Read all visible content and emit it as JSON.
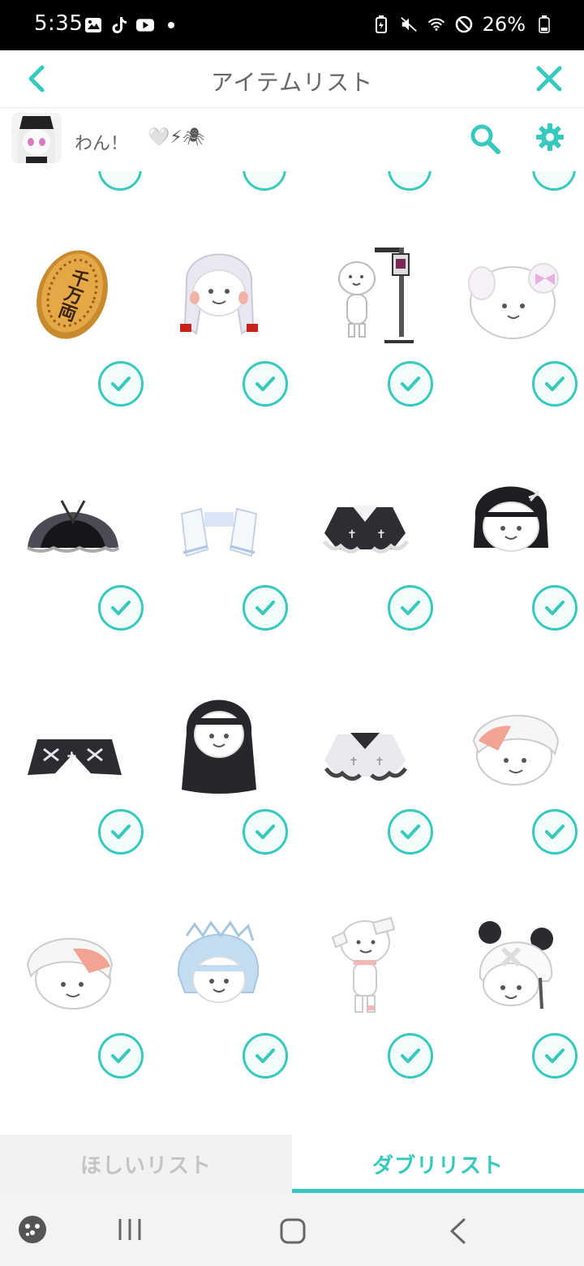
{
  "status_bar": {
    "time": "5:35",
    "battery": "26%"
  },
  "header": {
    "title": "アイテムリスト"
  },
  "user": {
    "name": "わん！",
    "emoji": "🤍⚡🕷"
  },
  "colors": {
    "accent": "#36c9bd",
    "tab_inactive_text": "#c4c4c4"
  },
  "items": [
    {
      "name": "千両-coin"
    },
    {
      "name": "white-braided-hair"
    },
    {
      "name": "iv-drip-stand"
    },
    {
      "name": "bunny-ear-clips"
    },
    {
      "name": "black-skirt"
    },
    {
      "name": "white-frill-cuffs"
    },
    {
      "name": "black-collar-top"
    },
    {
      "name": "black-bob-hair"
    },
    {
      "name": "black-cross-shorts"
    },
    {
      "name": "black-long-wavy-hair"
    },
    {
      "name": "white-collar-top"
    },
    {
      "name": "white-cap-right"
    },
    {
      "name": "white-cap-left"
    },
    {
      "name": "blue-messy-hair"
    },
    {
      "name": "bandage-body"
    },
    {
      "name": "panda-helmet"
    }
  ],
  "tabs": {
    "want_list": "ほしいリスト",
    "duplicate_list": "ダブリリスト"
  },
  "icons": {
    "back": "chevron-left-icon",
    "close": "close-icon",
    "search": "search-icon",
    "settings": "gear-icon",
    "check": "check-icon"
  }
}
